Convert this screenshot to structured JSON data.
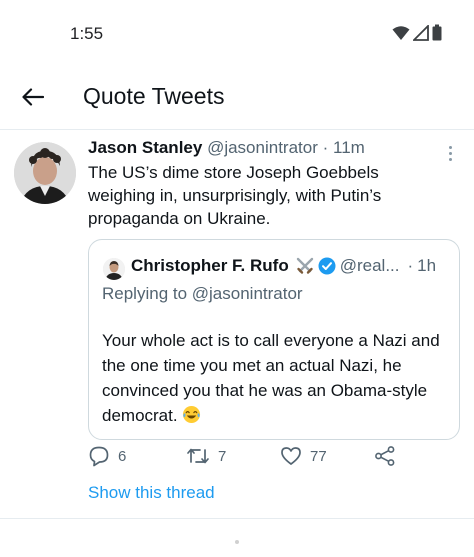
{
  "status_bar": {
    "time": "1:55",
    "icons": [
      "wifi-icon",
      "signal-icon",
      "battery-icon"
    ]
  },
  "header": {
    "back_icon": "arrow-left-icon",
    "title": "Quote Tweets"
  },
  "tweet": {
    "author_name": "Jason Stanley",
    "author_handle": "@jasonintrator",
    "separator": "·",
    "time": "11m",
    "text": "The US’s dime store Joseph Goebbels weighing in, unsurprisingly, with Putin’s propaganda on Ukraine.",
    "quote": {
      "author_name": "Christopher F. Rufo",
      "badges": [
        "crossed-swords-icon",
        "verified-badge-icon"
      ],
      "handle": "@real...",
      "separator": "·",
      "time": "1h",
      "replying_to": "Replying to @jasonintrator",
      "text": "Your whole act is to call everyone a Nazi and the one time you met an actual Nazi, he convinced you that he was an Obama-style democrat.",
      "emoji": "face-with-tears-of-joy"
    },
    "actions": {
      "replies": "6",
      "retweets": "7",
      "likes": "77"
    },
    "show_thread": "Show this thread"
  },
  "colors": {
    "link": "#1d9bf0",
    "secondary_text": "#536471",
    "primary_text": "#0f1419",
    "border": "#cfd9de",
    "verified": "#1d9bf0"
  }
}
